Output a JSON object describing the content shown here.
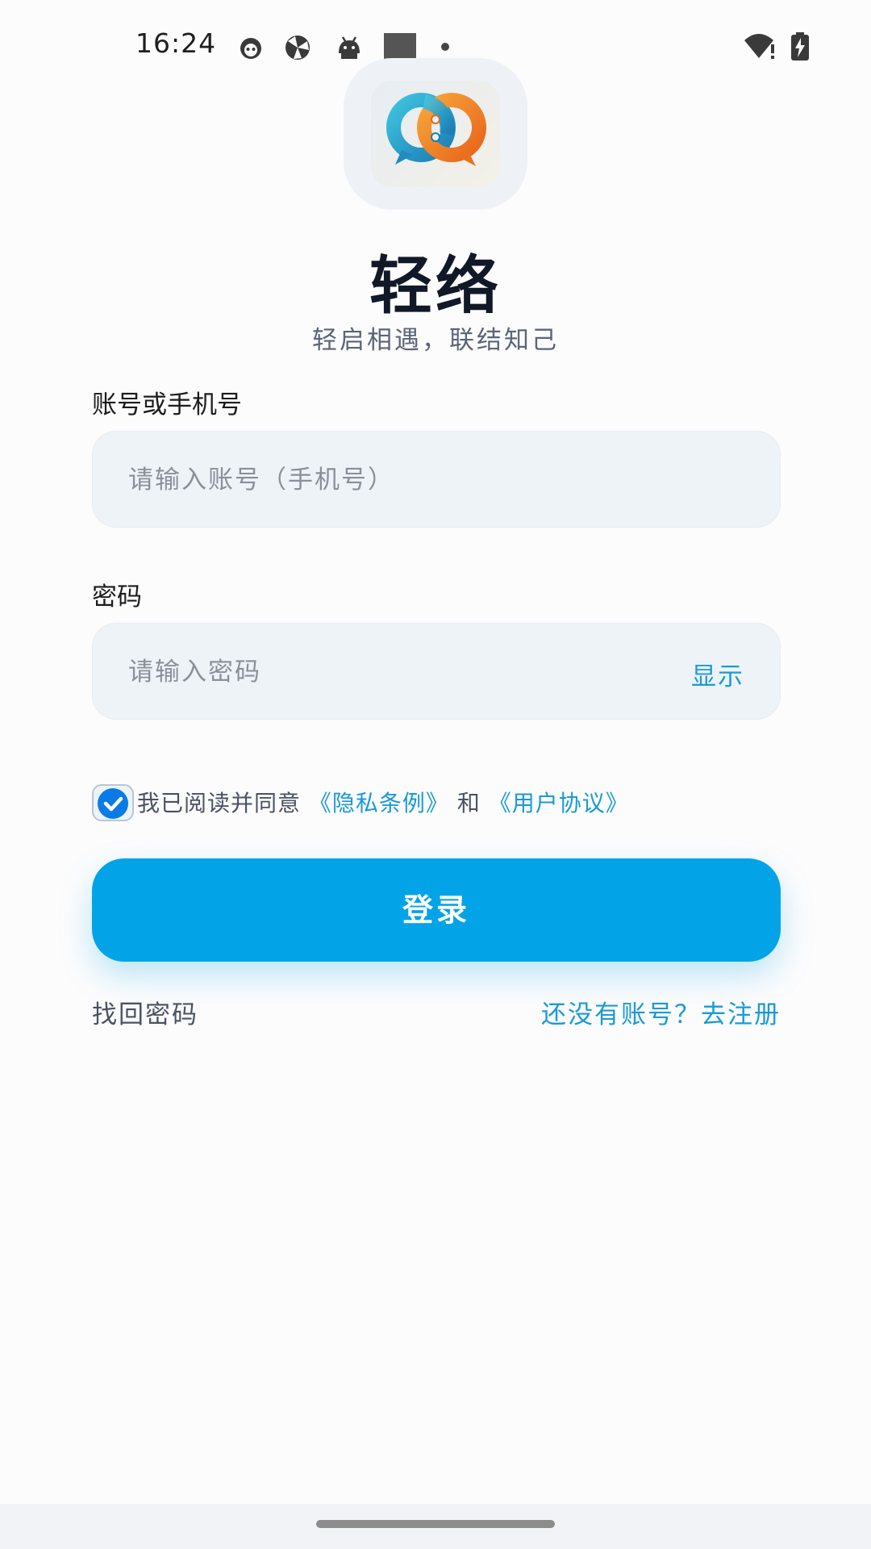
{
  "status_bar": {
    "time": "16:24",
    "icons": [
      "cat-face-icon",
      "aperture-icon",
      "android-icon",
      "square-icon",
      "dot-icon",
      "wifi-alert-icon",
      "battery-charging-icon"
    ]
  },
  "app": {
    "name": "轻络",
    "slogan": "轻启相遇，联结知己",
    "logo_icon": "infinity-chat-logo-icon"
  },
  "account_field": {
    "label": "账号或手机号",
    "value": "",
    "placeholder": "请输入账号（手机号）"
  },
  "password_field": {
    "label": "密码",
    "value": "",
    "placeholder": "请输入密码",
    "toggle_label": "显示"
  },
  "agreement": {
    "checked": true,
    "prefix": "我已阅读并同意",
    "privacy_link": "《隐私条例》",
    "conjunction": "和",
    "terms_link": "《用户协议》"
  },
  "login_button_label": "登录",
  "forgot_password_label": "找回密码",
  "register_label": "还没有账号？去注册",
  "colors": {
    "accent": "#03a3e8",
    "link": "#1a9ad6",
    "checkbox": "#0a7be6",
    "input_bg": "#eef3f8",
    "title": "#111827"
  }
}
